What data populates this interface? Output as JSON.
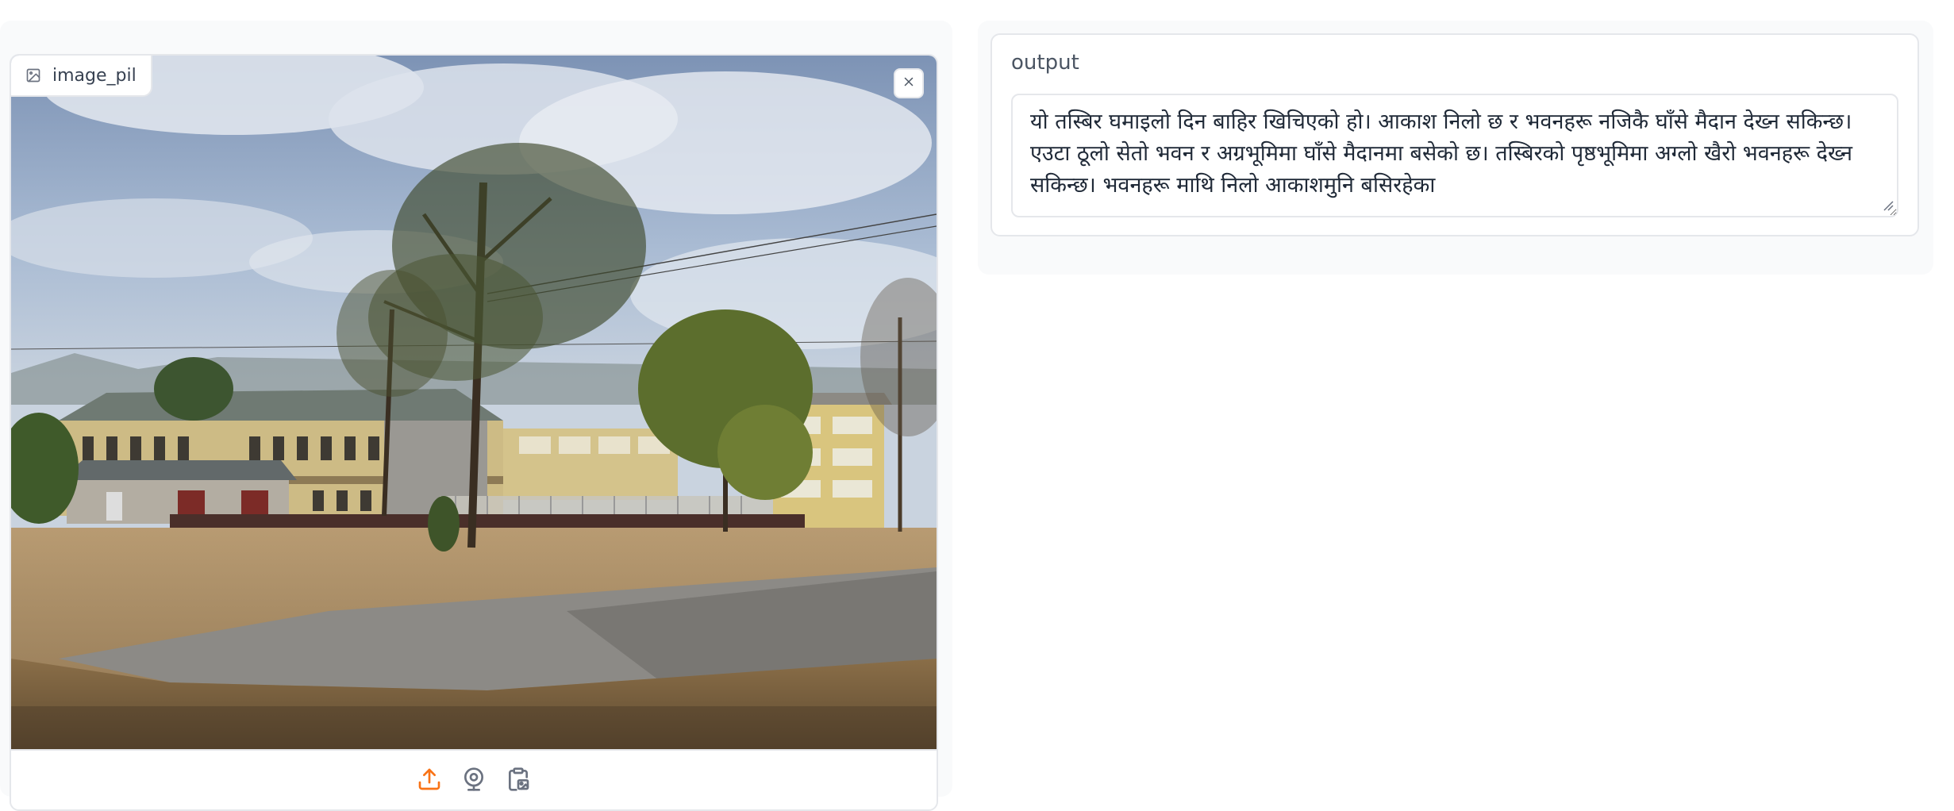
{
  "image_input": {
    "label": "image_pil",
    "icons": {
      "label": "image-icon",
      "clear": "close-icon",
      "upload": "upload-icon",
      "webcam": "webcam-icon",
      "clipboard": "clipboard-icon"
    },
    "colors": {
      "accent": "#f97316",
      "icon_gray": "#6b7280"
    }
  },
  "output": {
    "label": "output",
    "text": "यो तस्बिर घमाइलो दिन बाहिर खिचिएको हो। आकाश निलो छ र भवनहरू नजिकै घाँसे मैदान देख्न सकिन्छ। एउटा ठूलो सेतो भवन र अग्रभूमिमा घाँसे मैदानमा बसेको छ। तस्बिरको पृष्ठभूमिमा अग्लो खैरो भवनहरू देख्न सकिन्छ। भवनहरू माथि निलो आकाशमुनि बसिरहेका"
  }
}
